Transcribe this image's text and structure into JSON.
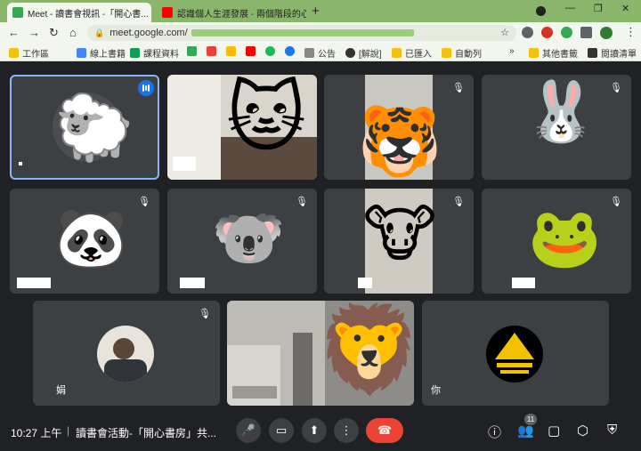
{
  "browser": {
    "tabs": [
      {
        "title": "Meet - 讀書會視訊 -「開心書...",
        "close": "×"
      },
      {
        "title": "認識個人生涯發展 - 兩個階段的心...",
        "close": "×"
      }
    ],
    "new_tab": "+",
    "window_controls": [
      "—",
      "❐",
      "✕"
    ],
    "url": "meet.google.com/",
    "bookmarks": [
      "工作區",
      "線上書籍",
      "課程資料",
      "公告",
      "[解說]",
      "已匯入",
      "自動列",
      "其他書籤",
      "閱讀清單"
    ],
    "colors": {
      "tab_strip": "#8ab66b",
      "toolbar": "#f3f6ef"
    }
  },
  "meet": {
    "participants": [
      {
        "avatar": "sheep",
        "name": "",
        "muted": false,
        "speaking": true
      },
      {
        "avatar": "cat",
        "name": "",
        "muted": false,
        "speaking": false
      },
      {
        "avatar": "tiger",
        "name": "",
        "muted": true,
        "speaking": false
      },
      {
        "avatar": "rabbit",
        "name": "",
        "muted": true,
        "speaking": false
      },
      {
        "avatar": "panda",
        "name": "",
        "muted": true,
        "speaking": false
      },
      {
        "avatar": "koala",
        "name": "",
        "muted": true,
        "speaking": false
      },
      {
        "avatar": "cow",
        "name": "",
        "muted": true,
        "speaking": false
      },
      {
        "avatar": "frog",
        "name": "",
        "muted": true,
        "speaking": false
      },
      {
        "avatar": "photo-person",
        "name": "娟",
        "muted": true,
        "speaking": false
      },
      {
        "avatar": "lion",
        "name": "",
        "muted": false,
        "speaking": false
      },
      {
        "avatar": "school-logo",
        "name": "你",
        "muted": false,
        "speaking": false
      }
    ],
    "bottom_bar": {
      "time": "10:27 上午",
      "meeting_name": "讀書會活動-「開心書房」共...",
      "participant_count": "11"
    },
    "colors": {
      "background": "#202124",
      "tile": "#3c4043",
      "end_call": "#ea4335",
      "active_border": "#8ab4f8"
    }
  }
}
